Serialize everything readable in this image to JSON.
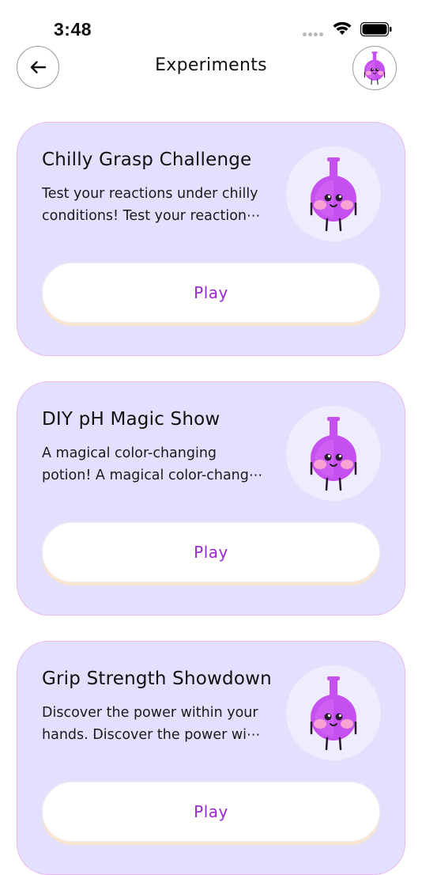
{
  "status_bar": {
    "time": "3:48"
  },
  "nav": {
    "title": "Experiments",
    "back_icon": "arrow-left-icon",
    "avatar_icon": "flask-mascot-icon"
  },
  "colors": {
    "card_background": "#e2e0fd",
    "card_border": "#ebb9ee",
    "play_text": "#9b27d4",
    "mascot_body": "#c64ff0"
  },
  "experiments": [
    {
      "title": "Chilly Grasp Challenge",
      "description": "Test your reactions under chilly conditions! Test your reactions under chilly conditions!",
      "button_label": "Play",
      "image_icon": "flask-mascot-icon"
    },
    {
      "title": "DIY pH Magic Show",
      "description": "A magical color-changing potion! A magical color-changing potion!A magical color-changing potion!",
      "button_label": "Play",
      "image_icon": "flask-mascot-icon"
    },
    {
      "title": "Grip Strength Showdown",
      "description": "Discover the power within your hands. Discover the power within your hands.",
      "button_label": "Play",
      "image_icon": "flask-mascot-icon"
    }
  ]
}
